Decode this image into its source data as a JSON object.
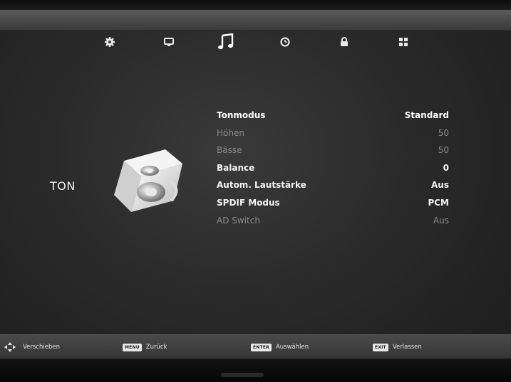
{
  "tabs": [
    {
      "name": "picture",
      "icon": "gear-icon"
    },
    {
      "name": "channel",
      "icon": "monitor-icon"
    },
    {
      "name": "sound",
      "icon": "music-note-icon",
      "active": true
    },
    {
      "name": "time",
      "icon": "clock-icon"
    },
    {
      "name": "lock",
      "icon": "lock-icon"
    },
    {
      "name": "setup",
      "icon": "grid-icon"
    }
  ],
  "section": {
    "label": "TON",
    "icon": "speaker-icon"
  },
  "menu": {
    "items": [
      {
        "label": "Tonmodus",
        "value": "Standard",
        "state": "selected"
      },
      {
        "label": "Höhen",
        "value": "50",
        "state": "disabled"
      },
      {
        "label": "Bässe",
        "value": "50",
        "state": "disabled"
      },
      {
        "label": "Balance",
        "value": "0",
        "state": "enabled"
      },
      {
        "label": "Autom. Lautstärke",
        "value": "Aus",
        "state": "enabled"
      },
      {
        "label": "SPDIF Modus",
        "value": "PCM",
        "state": "enabled"
      },
      {
        "label": "AD Switch",
        "value": "Aus",
        "state": "disabled"
      }
    ]
  },
  "footer": {
    "move": {
      "icon": "dpad-icon",
      "label": "Verschieben"
    },
    "back": {
      "key": "MENU",
      "label": "Zurück"
    },
    "select": {
      "key": "ENTER",
      "label": "Auswählen"
    },
    "exit": {
      "key": "EXIT",
      "label": "Verlassen"
    }
  },
  "colors": {
    "text": "#eaeaea",
    "disabled": "#8a8a8a",
    "bar": "#3b3b3b"
  }
}
